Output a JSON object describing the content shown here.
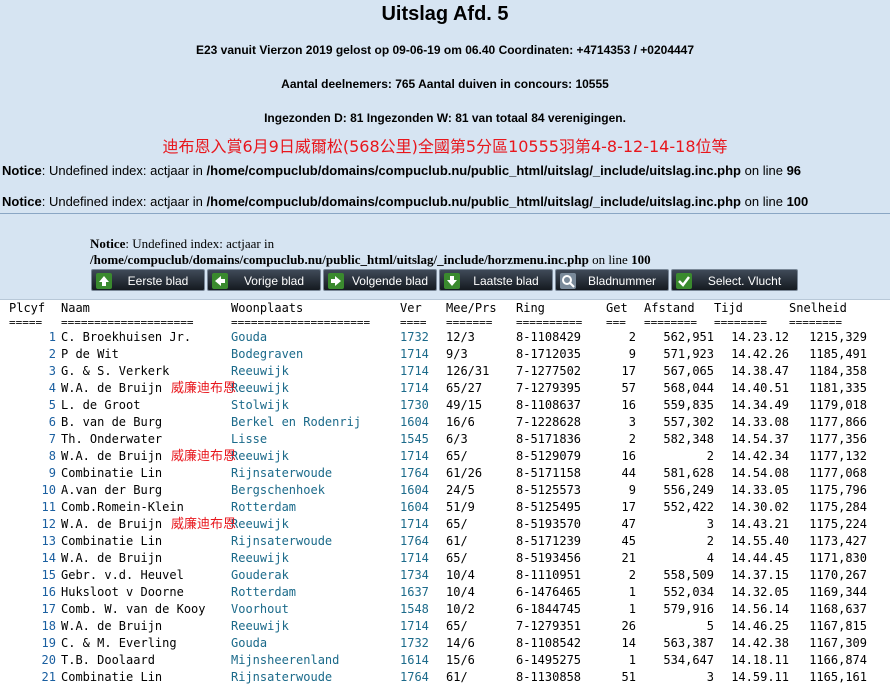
{
  "header": {
    "title": "Uitslag Afd. 5",
    "line1": "E23 vanuit Vierzon 2019 gelost op 09-06-19 om 06.40 Coordinaten: +4714353 / +0204447",
    "line2": "Aantal deelnemers: 765 Aantal duiven in concours: 10555",
    "line3": "Ingezonden D: 81 Ingezonden W: 81 van totaal 84 verenigingen.",
    "chinese": "迪布恩入賞6月9日威爾松(568公里)全國第5分區10555羽第4-8-12-14-18位等"
  },
  "notices": [
    {
      "label": "Notice",
      "text": ": Undefined index: actjaar in ",
      "path": "/home/compuclub/domains/compuclub.nu/public_html/uitslag/_include/uitslag.inc.php",
      "online": " on line ",
      "line": "96"
    },
    {
      "label": "Notice",
      "text": ": Undefined index: actjaar in ",
      "path": "/home/compuclub/domains/compuclub.nu/public_html/uitslag/_include/uitslag.inc.php",
      "online": " on line ",
      "line": "100"
    }
  ],
  "notice3": {
    "label": "Notice",
    "text": ": Undefined index: actjaar in ",
    "path": "/home/compuclub/domains/compuclub.nu/public_html/uitslag/_include/horzmenu.inc.php",
    "online": " on line ",
    "line": "100"
  },
  "nav": [
    {
      "label": "Eerste blad",
      "icon": "arrow-up-icon"
    },
    {
      "label": "Vorige blad",
      "icon": "arrow-left-icon"
    },
    {
      "label": "Volgende blad",
      "icon": "arrow-right-icon"
    },
    {
      "label": "Laatste blad",
      "icon": "arrow-down-icon"
    },
    {
      "label": "Bladnummer",
      "icon": "magnifier-icon"
    },
    {
      "label": "Select. Vlucht",
      "icon": "checkbox-icon"
    }
  ],
  "table": {
    "headers": [
      "Plcyf",
      "Naam",
      "Woonplaats",
      "Ver",
      "Mee/Prs",
      "Ring",
      "Get",
      "Afstand",
      "Tijd",
      "Snelheid"
    ],
    "separators": [
      "=====",
      "====================",
      "=====================",
      "====",
      "=======",
      "==========",
      "===",
      "========",
      "========",
      "========"
    ],
    "overlay_text": "威廉迪布恩",
    "rows": [
      {
        "pl": "1",
        "naam": "C. Broekhuisen Jr.",
        "woon": "Gouda",
        "ver": "1732",
        "mee": "12/3",
        "ring": "8-1108429",
        "get": "2",
        "afs": "562,951",
        "tijd": "14.23.12",
        "snel": "1215,329",
        "overlay": false
      },
      {
        "pl": "2",
        "naam": "P de Wit",
        "woon": "Bodegraven",
        "ver": "1714",
        "mee": "9/3",
        "ring": "8-1712035",
        "get": "9",
        "afs": "571,923",
        "tijd": "14.42.26",
        "snel": "1185,491",
        "overlay": false
      },
      {
        "pl": "3",
        "naam": "G. & S. Verkerk",
        "woon": "Reeuwijk",
        "ver": "1714",
        "mee": "126/31",
        "ring": "7-1277502",
        "get": "17",
        "afs": "567,065",
        "tijd": "14.38.47",
        "snel": "1184,358",
        "overlay": false
      },
      {
        "pl": "4",
        "naam": "W.A. de Bruijn",
        "woon": "Reeuwijk",
        "ver": "1714",
        "mee": "65/27",
        "ring": "7-1279395",
        "get": "57",
        "afs": "568,044",
        "tijd": "14.40.51",
        "snel": "1181,335",
        "overlay": true
      },
      {
        "pl": "5",
        "naam": "L. de Groot",
        "woon": "Stolwijk",
        "ver": "1730",
        "mee": "49/15",
        "ring": "8-1108637",
        "get": "16",
        "afs": "559,835",
        "tijd": "14.34.49",
        "snel": "1179,018",
        "overlay": false
      },
      {
        "pl": "6",
        "naam": "B. van de Burg",
        "woon": "Berkel en Rodenrij",
        "ver": "1604",
        "mee": "16/6",
        "ring": "7-1228628",
        "get": "3",
        "afs": "557,302",
        "tijd": "14.33.08",
        "snel": "1177,866",
        "overlay": false
      },
      {
        "pl": "7",
        "naam": "Th. Onderwater",
        "woon": "Lisse",
        "ver": "1545",
        "mee": "6/3",
        "ring": "8-5171836",
        "get": "2",
        "afs": "582,348",
        "tijd": "14.54.37",
        "snel": "1177,356",
        "overlay": false
      },
      {
        "pl": "8",
        "naam": "W.A. de Bruijn",
        "woon": "Reeuwijk",
        "ver": "1714",
        "mee": "65/",
        "ring": "8-5129079",
        "get": "16",
        "afs": "2",
        "tijd": "14.42.34",
        "snel": "1177,132",
        "overlay": true
      },
      {
        "pl": "9",
        "naam": "Combinatie Lin",
        "woon": "Rijnsaterwoude",
        "ver": "1764",
        "mee": "61/26",
        "ring": "8-5171158",
        "get": "44",
        "afs": "581,628",
        "tijd": "14.54.08",
        "snel": "1177,068",
        "overlay": false
      },
      {
        "pl": "10",
        "naam": "A.van der Burg",
        "woon": "Bergschenhoek",
        "ver": "1604",
        "mee": "24/5",
        "ring": "8-5125573",
        "get": "9",
        "afs": "556,249",
        "tijd": "14.33.05",
        "snel": "1175,796",
        "overlay": false
      },
      {
        "pl": "11",
        "naam": "Comb.Romein-Klein",
        "woon": "Rotterdam",
        "ver": "1604",
        "mee": "51/9",
        "ring": "8-5125495",
        "get": "17",
        "afs": "552,422",
        "tijd": "14.30.02",
        "snel": "1175,284",
        "overlay": false
      },
      {
        "pl": "12",
        "naam": "W.A. de Bruijn",
        "woon": "Reeuwijk",
        "ver": "1714",
        "mee": "65/",
        "ring": "8-5193570",
        "get": "47",
        "afs": "3",
        "tijd": "14.43.21",
        "snel": "1175,224",
        "overlay": true
      },
      {
        "pl": "13",
        "naam": "Combinatie Lin",
        "woon": "Rijnsaterwoude",
        "ver": "1764",
        "mee": "61/",
        "ring": "8-5171239",
        "get": "45",
        "afs": "2",
        "tijd": "14.55.40",
        "snel": "1173,427",
        "overlay": false
      },
      {
        "pl": "14",
        "naam": "W.A. de Bruijn",
        "woon": "Reeuwijk",
        "ver": "1714",
        "mee": "65/",
        "ring": "8-5193456",
        "get": "21",
        "afs": "4",
        "tijd": "14.44.45",
        "snel": "1171,830",
        "overlay": false
      },
      {
        "pl": "15",
        "naam": "Gebr. v.d. Heuvel",
        "woon": "Gouderak",
        "ver": "1734",
        "mee": "10/4",
        "ring": "8-1110951",
        "get": "2",
        "afs": "558,509",
        "tijd": "14.37.15",
        "snel": "1170,267",
        "overlay": false
      },
      {
        "pl": "16",
        "naam": "Huksloot v Doorne",
        "woon": "Rotterdam",
        "ver": "1637",
        "mee": "10/4",
        "ring": "6-1476465",
        "get": "1",
        "afs": "552,034",
        "tijd": "14.32.05",
        "snel": "1169,344",
        "overlay": false
      },
      {
        "pl": "17",
        "naam": "Comb. W. van de Kooy",
        "woon": "Voorhout",
        "ver": "1548",
        "mee": "10/2",
        "ring": "6-1844745",
        "get": "1",
        "afs": "579,916",
        "tijd": "14.56.14",
        "snel": "1168,637",
        "overlay": false
      },
      {
        "pl": "18",
        "naam": "W.A. de Bruijn",
        "woon": "Reeuwijk",
        "ver": "1714",
        "mee": "65/",
        "ring": "7-1279351",
        "get": "26",
        "afs": "5",
        "tijd": "14.46.25",
        "snel": "1167,815",
        "overlay": false
      },
      {
        "pl": "19",
        "naam": "C. & M. Everling",
        "woon": "Gouda",
        "ver": "1732",
        "mee": "14/6",
        "ring": "8-1108542",
        "get": "14",
        "afs": "563,387",
        "tijd": "14.42.38",
        "snel": "1167,309",
        "overlay": false
      },
      {
        "pl": "20",
        "naam": "T.B. Doolaard",
        "woon": "Mijnsheerenland",
        "ver": "1614",
        "mee": "15/6",
        "ring": "6-1495275",
        "get": "1",
        "afs": "534,647",
        "tijd": "14.18.11",
        "snel": "1166,874",
        "overlay": false
      },
      {
        "pl": "21",
        "naam": "Combinatie Lin",
        "woon": "Rijnsaterwoude",
        "ver": "1764",
        "mee": "61/",
        "ring": "8-1130858",
        "get": "51",
        "afs": "3",
        "tijd": "14.59.11",
        "snel": "1165,161",
        "overlay": false
      }
    ]
  },
  "colors": {
    "background": "#d6e4f2",
    "accent_red": "#e8161c",
    "link_blue": "#1b6a8a",
    "button_dark": "#1e252e",
    "icon_green": "#3a8a2e"
  }
}
